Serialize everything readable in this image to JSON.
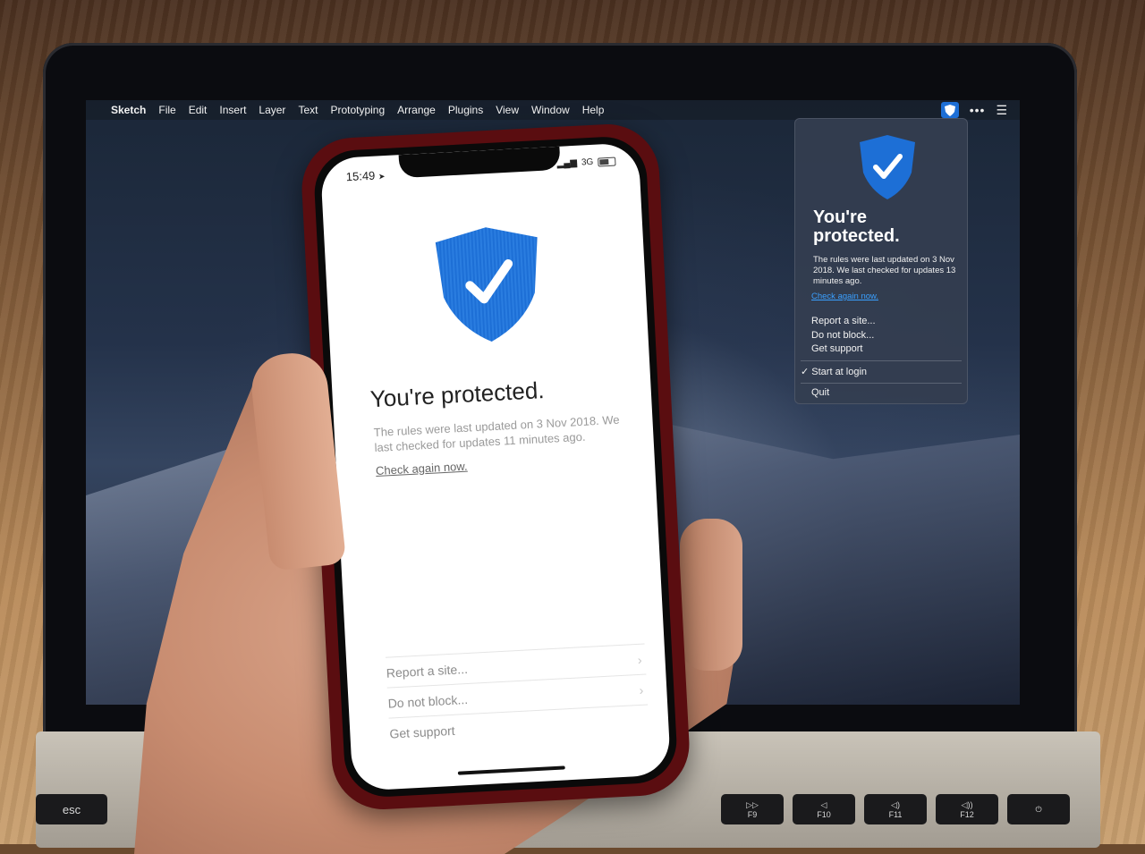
{
  "mac": {
    "menubar": {
      "items": [
        "Sketch",
        "File",
        "Edit",
        "Insert",
        "Layer",
        "Text",
        "Prototyping",
        "Arrange",
        "Plugins",
        "View",
        "Window",
        "Help"
      ]
    },
    "popover": {
      "title_line1": "You're",
      "title_line2": "protected.",
      "description": "The rules were last updated on 3 Nov 2018. We last checked for updates 13 minutes ago.",
      "check_link": "Check again now.",
      "menu": {
        "report": "Report a site...",
        "do_not_block": "Do not block...",
        "support": "Get support",
        "start_at_login": "Start at login",
        "start_at_login_checked": true,
        "quit": "Quit"
      }
    },
    "keyboard": {
      "esc": "esc",
      "keys": [
        "F9",
        "F10",
        "F11",
        "F12"
      ]
    }
  },
  "phone": {
    "status": {
      "time": "15:49",
      "network": "3G"
    },
    "title": "You're protected.",
    "description": "The rules were last updated on 3 Nov 2018. We last checked for updates 11 minutes ago.",
    "check_link": "Check again now.",
    "rows": [
      "Report a site...",
      "Do not block...",
      "Get support"
    ]
  },
  "colors": {
    "shield": "#1d6fd6",
    "link": "#3aa0ff"
  }
}
